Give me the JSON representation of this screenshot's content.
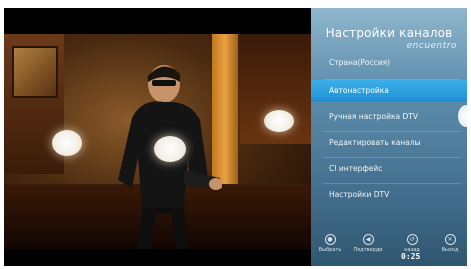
{
  "menu": {
    "title": "Настройки каналов",
    "subtitle": "encuentro",
    "items": [
      {
        "label": "Страна(Россия)",
        "active": false
      },
      {
        "label": "Автонастройка",
        "active": true
      },
      {
        "label": "Ручная настройка DTV",
        "active": false
      },
      {
        "label": "Редактировать каналы",
        "active": false
      },
      {
        "label": "CI интерфейс",
        "active": false
      },
      {
        "label": "Настройки DTV",
        "active": false
      }
    ]
  },
  "footer": {
    "buttons": [
      {
        "label": "Выбрать",
        "icon": "ok-icon"
      },
      {
        "label": "Подтверди",
        "icon": "confirm-icon"
      },
      {
        "label": "назад",
        "icon": "back-icon"
      },
      {
        "label": "Выход",
        "icon": "exit-icon"
      }
    ],
    "clock": "0:25"
  },
  "colors": {
    "accent": "#2a9fe0",
    "panel": "#5a8aa8"
  }
}
